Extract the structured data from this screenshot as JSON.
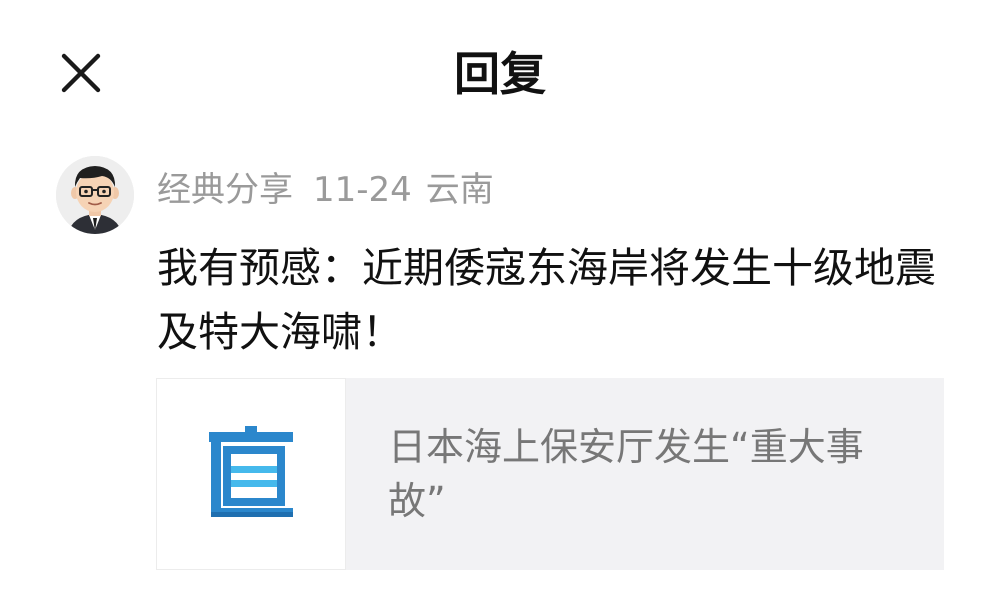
{
  "header": {
    "close_icon": "close-icon",
    "title": "回复"
  },
  "comment": {
    "author": "经典分享",
    "date": "11-24",
    "location": "云南",
    "text": "我有预感：近期倭寇东海岸将发生十级地震及特大海啸！",
    "avatar_icon": "cartoon-man-avatar"
  },
  "link_card": {
    "logo_icon": "zhi-news-logo-icon",
    "logo_char": "直",
    "title": "日本海上保安厅发生“重大事故”"
  },
  "colors": {
    "logo_blue": "#2b87cc",
    "logo_light": "#45b9ec",
    "meta_gray": "#9a9a9a",
    "card_bg": "#f2f2f4"
  }
}
